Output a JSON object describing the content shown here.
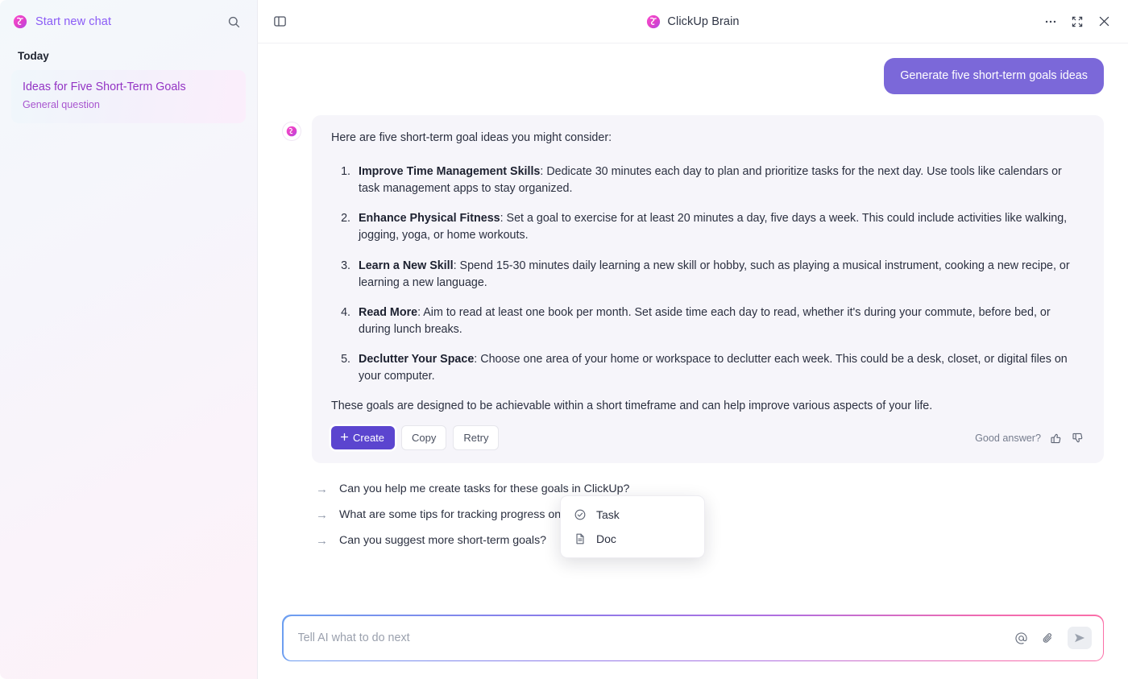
{
  "sidebar": {
    "new_chat_label": "Start new chat",
    "logo_icon": "clickup-brain-logo-icon",
    "search_icon": "search-icon",
    "section_title": "Today",
    "chats": [
      {
        "title": "Ideas for Five Short-Term Goals",
        "subtitle": "General question"
      }
    ]
  },
  "header": {
    "panel_toggle_icon": "sidebar-panel-toggle-icon",
    "logo_icon": "clickup-brain-logo-icon",
    "title": "ClickUp Brain",
    "more_icon": "ellipsis-icon",
    "expand_icon": "expand-icon",
    "close_icon": "close-icon"
  },
  "conversation": {
    "user_message": "Generate five short-term goals ideas",
    "ai_avatar_icon": "clickup-brain-avatar-icon",
    "ai_intro": "Here are five short-term goal ideas you might consider:",
    "goals": [
      {
        "title": "Improve Time Management Skills",
        "body": ": Dedicate 30 minutes each day to plan and prioritize tasks for the next day. Use tools like calendars or task management apps to stay organized."
      },
      {
        "title": "Enhance Physical Fitness",
        "body": ": Set a goal to exercise for at least 20 minutes a day, five days a week. This could include activities like walking, jogging, yoga, or home workouts."
      },
      {
        "title": "Learn a New Skill",
        "body": ": Spend 15-30 minutes daily learning a new skill or hobby, such as playing a musical instrument, cooking a new recipe, or learning a new language."
      },
      {
        "title": "Read More",
        "body": ": Aim to read at least one book per month. Set aside time each day to read, whether it's during your commute, before bed, or during lunch breaks."
      },
      {
        "title": "Declutter Your Space",
        "body": ": Choose one area of your home or workspace to declutter each week. This could be a desk, closet, or digital files on your computer."
      }
    ],
    "ai_outro": "These goals are designed to be achievable within a short timeframe and can help improve various aspects of your life."
  },
  "actions": {
    "create_label": "Create",
    "create_plus_icon": "plus-icon",
    "copy_label": "Copy",
    "retry_label": "Retry",
    "feedback_label": "Good answer?",
    "thumbs_up_icon": "thumbs-up-icon",
    "thumbs_down_icon": "thumbs-down-icon"
  },
  "create_menu": {
    "items": [
      {
        "label": "Task",
        "icon": "check-circle-icon"
      },
      {
        "label": "Doc",
        "icon": "document-icon"
      }
    ]
  },
  "suggestions": {
    "arrow_icon": "arrow-right-icon",
    "items": [
      "Can you help me create tasks for these goals in ClickUp?",
      "What are some tips for tracking progress on these goals?",
      "Can you suggest more short-term goals?"
    ]
  },
  "composer": {
    "placeholder": "Tell AI what to do next",
    "value": "",
    "mention_icon": "at-mention-icon",
    "attach_icon": "paperclip-icon",
    "send_icon": "send-icon"
  },
  "colors": {
    "user_bubble": "#7b68d9",
    "create_button": "#5b45cf",
    "sidebar_accent": "#9333c4",
    "new_chat_accent": "#8b5cf6"
  }
}
